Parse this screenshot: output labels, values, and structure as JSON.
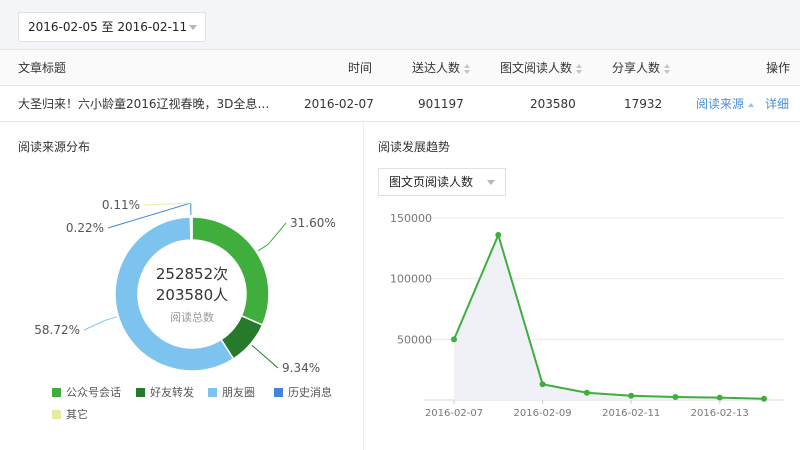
{
  "date_range": "2016-02-05 至 2016-02-11",
  "table": {
    "headers": {
      "title": "文章标题",
      "time": "时间",
      "delivered": "送达人数",
      "reads": "图文阅读人数",
      "shares": "分享人数",
      "actions": "操作"
    },
    "row": {
      "title": "大圣归来！六小龄童2016辽视春晚，3D全息…",
      "time": "2016-02-07",
      "delivered": "901197",
      "reads": "203580",
      "shares": "17932",
      "action_source": "阅读来源",
      "action_detail": "详细"
    }
  },
  "donut": {
    "title": "阅读来源分布",
    "center_line1": "252852次",
    "center_line2": "203580人",
    "center_caption": "阅读总数",
    "slices": [
      {
        "name": "公众号会话",
        "percent": 31.6,
        "label": "31.60%",
        "color": "#3fae3c"
      },
      {
        "name": "好友转发",
        "percent": 9.34,
        "label": "9.34%",
        "color": "#257a2b"
      },
      {
        "name": "朋友圈",
        "percent": 58.72,
        "label": "58.72%",
        "color": "#7cc4ef"
      },
      {
        "name": "历史消息",
        "percent": 0.22,
        "label": "0.22%",
        "color": "#3d86d9"
      },
      {
        "name": "其它",
        "percent": 0.11,
        "label": "0.11%",
        "color": "#e4eca4"
      }
    ]
  },
  "trend": {
    "title": "阅读发展趋势",
    "metric_select": "图文页阅读人数"
  },
  "chart_data": {
    "type": "area",
    "title": "",
    "xlabel": "",
    "ylabel": "",
    "x": [
      "2016-02-07",
      "2016-02-08",
      "2016-02-09",
      "2016-02-10",
      "2016-02-11",
      "2016-02-12",
      "2016-02-13",
      "2016-02-14"
    ],
    "x_tick_labels": [
      "2016-02-07",
      "2016-02-09",
      "2016-02-11",
      "2016-02-13"
    ],
    "series": [
      {
        "values": [
          50000,
          136000,
          13000,
          6000,
          3500,
          2500,
          2000,
          1000
        ],
        "color": "#3fae3c"
      }
    ],
    "y_tick_labels": [
      "50000",
      "100000",
      "150000"
    ],
    "ylim": [
      0,
      150000
    ],
    "grid": true
  }
}
